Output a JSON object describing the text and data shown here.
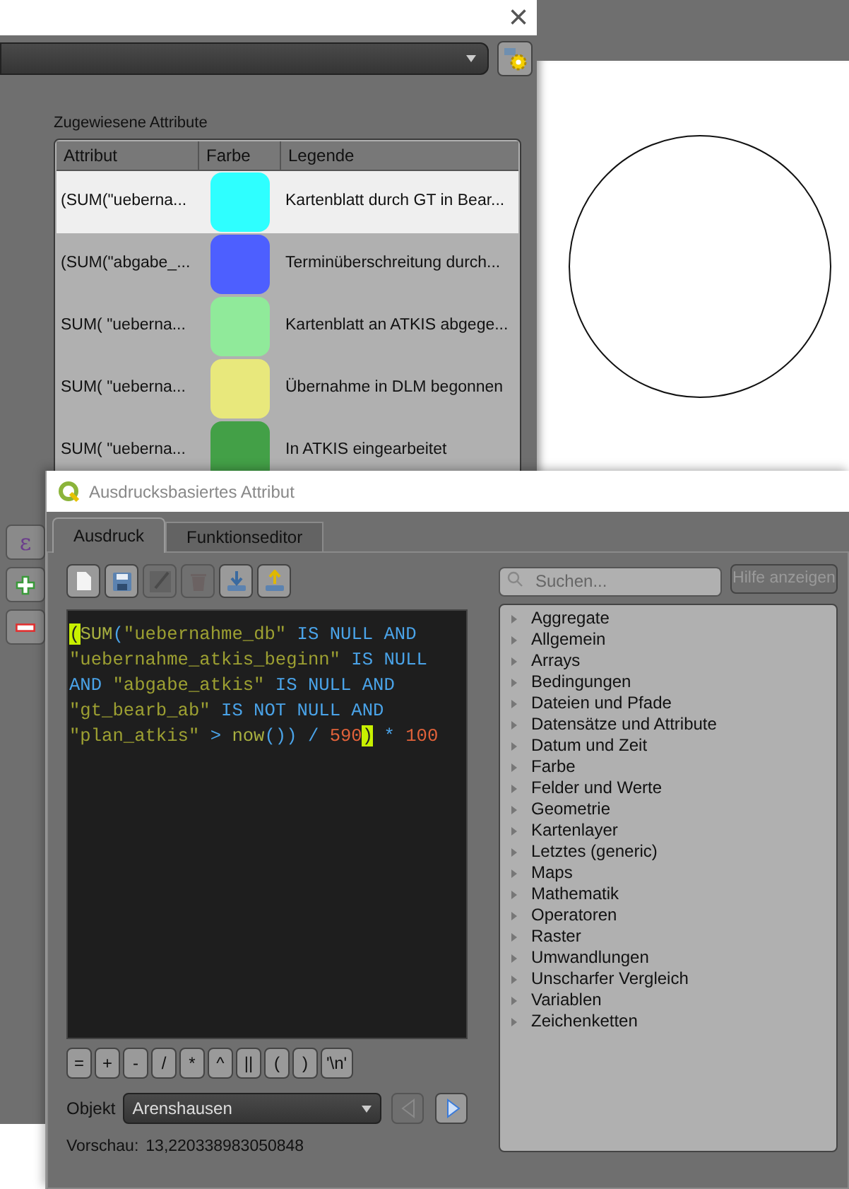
{
  "back_window": {
    "close_glyph": "×",
    "side_buttons": [
      {
        "kind": "expression",
        "label": "ε"
      },
      {
        "kind": "add"
      },
      {
        "kind": "remove"
      }
    ],
    "assigned_attributes": {
      "label": "Zugewiesene Attribute",
      "columns": [
        "Attribut",
        "Farbe",
        "Legende"
      ],
      "rows": [
        {
          "attribute": "(SUM(\"ueberna...",
          "color": "#2effff",
          "legend": "Kartenblatt durch GT in Bear...",
          "selected": true
        },
        {
          "attribute": "(SUM(\"abgabe_...",
          "color": "#4d5fff",
          "legend": "Terminüberschreitung durch...",
          "selected": false
        },
        {
          "attribute": "SUM( \"ueberna...",
          "color": "#90ea9a",
          "legend": "Kartenblatt an ATKIS abgege...",
          "selected": false
        },
        {
          "attribute": "SUM( \"ueberna...",
          "color": "#e8e87c",
          "legend": "Übernahme in DLM begonnen",
          "selected": false
        },
        {
          "attribute": "SUM( \"ueberna...",
          "color": "#43a047",
          "legend": "In ATKIS eingearbeitet",
          "selected": false
        }
      ]
    }
  },
  "dialog": {
    "title": "Ausdrucksbasiertes Attribut",
    "tabs": [
      {
        "label": "Ausdruck",
        "selected": true
      },
      {
        "label": "Funktionseditor",
        "selected": false
      }
    ],
    "toolbar": [
      {
        "kind": "new",
        "disabled": false
      },
      {
        "kind": "save",
        "disabled": false
      },
      {
        "kind": "edit",
        "disabled": true
      },
      {
        "kind": "delete",
        "disabled": true
      },
      {
        "kind": "import",
        "disabled": false
      },
      {
        "kind": "export",
        "disabled": false
      }
    ],
    "code_lines": [
      [
        {
          "kind": "match",
          "text": "("
        },
        {
          "kind": "func",
          "text": "SUM"
        },
        {
          "kind": "op",
          "text": "("
        },
        {
          "kind": "string",
          "text": "\"uebernahme_db\""
        },
        {
          "kind": "keyword",
          "text": " IS NULL AND"
        }
      ],
      [
        {
          "kind": "string",
          "text": "\"uebernahme_atkis_beginn\""
        },
        {
          "kind": "keyword",
          "text": " IS NULL"
        }
      ],
      [
        {
          "kind": "keyword",
          "text": "AND "
        },
        {
          "kind": "string",
          "text": "\"abgabe_atkis\""
        },
        {
          "kind": "keyword",
          "text": " IS NULL AND"
        }
      ],
      [
        {
          "kind": "string",
          "text": "\"gt_bearb_ab\""
        },
        {
          "kind": "keyword",
          "text": " IS NOT NULL AND"
        }
      ],
      [
        {
          "kind": "string",
          "text": "\"plan_atkis\""
        },
        {
          "kind": "op",
          "text": " > "
        },
        {
          "kind": "func",
          "text": "now"
        },
        {
          "kind": "op",
          "text": "()) / "
        },
        {
          "kind": "number",
          "text": "590"
        },
        {
          "kind": "match",
          "text": ")"
        },
        {
          "kind": "op",
          "text": " * "
        },
        {
          "kind": "number",
          "text": "100"
        }
      ]
    ],
    "operators": [
      "=",
      "+",
      "-",
      "/",
      "*",
      "^",
      "||",
      "(",
      ")",
      "'\\n'"
    ],
    "object": {
      "label": "Objekt",
      "value": "Arenshausen"
    },
    "nav_buttons": [
      {
        "kind": "previous",
        "disabled": true
      },
      {
        "kind": "next",
        "disabled": false
      }
    ],
    "preview": {
      "label": "Vorschau:",
      "value": "13,220338983050848"
    },
    "search": {
      "placeholder": "Suchen..."
    },
    "help_button": {
      "label": "Hilfe anzeigen",
      "disabled": true
    },
    "function_groups": [
      "Aggregate",
      "Allgemein",
      "Arrays",
      "Bedingungen",
      "Dateien und Pfade",
      "Datensätze und Attribute",
      "Datum und Zeit",
      "Farbe",
      "Felder und Werte",
      "Geometrie",
      "Kartenlayer",
      "Letztes (generic)",
      "Maps",
      "Mathematik",
      "Operatoren",
      "Raster",
      "Umwandlungen",
      "Unscharfer Vergleich",
      "Variablen",
      "Zeichenketten"
    ]
  }
}
